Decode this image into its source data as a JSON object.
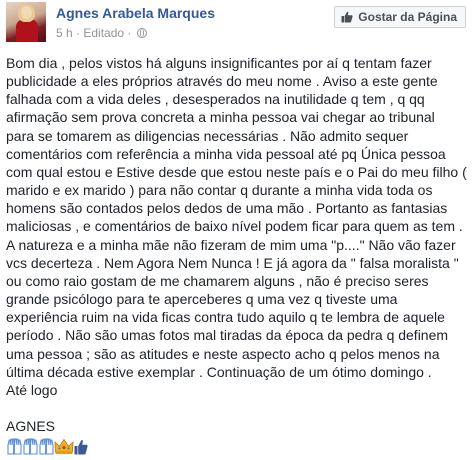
{
  "post": {
    "author": "Agnes Arabela Marques",
    "time": "5 h",
    "separator": "·",
    "edited": "Editado",
    "separator2": "·",
    "like_page_label": "Gostar da Página",
    "lines": [
      "Bom dia , pelos vistos há alguns insignificantes por aí q tentam fazer",
      "publicidade a eles próprios através do meu nome . Aviso a este gente",
      "falhada com a vida deles , desesperados na inutilidade q tem , q qq",
      "afirmação sem prova concreta a minha pessoa vai chegar ao tribunal",
      "para se tomarem as diligencias necessárias . Não admito sequer",
      "comentários com referência a minha vida pessoal até pq Única pessoa",
      "com qual estou e Estive desde que estou neste país e o Pai do meu filho (",
      "marido e ex marido ) para não contar q durante a minha vida toda os",
      "homens são contados pelos dedos de uma mão . Portanto as fantasias",
      "maliciosas , e comentários de baixo nível podem ficar para quem as tem .",
      "A natureza e a minha mãe não fizeram de mim uma \"p....\" Não vão fazer",
      "vcs decerteza . Nem Agora Nem Nunca ! E já agora da \" falsa moralista \"",
      "ou como raio gostam de me chamarem alguns , não é preciso seres",
      "grande psicólogo para te aperceberes q uma vez q tiveste uma",
      "experiência ruim na vida ficas contra tudo aquilo q te lembra de aquele",
      "período . Não são umas fotos mal tiradas da época da pedra q definem",
      "uma pessoa ; são as atitudes e neste aspecto acho q pelos menos na",
      "última década estive exemplar . Continuação de um ótimo domingo .",
      "Até logo"
    ],
    "signature": "AGNES",
    "emojis": [
      "raised-hands-icon",
      "raised-hands-icon",
      "raised-hands-icon",
      "crown-icon",
      "thumbs-up-icon"
    ]
  },
  "colors": {
    "author": "#365899",
    "meta": "#90949c",
    "text": "#1d2129",
    "button_bg": "#f6f7f9"
  }
}
